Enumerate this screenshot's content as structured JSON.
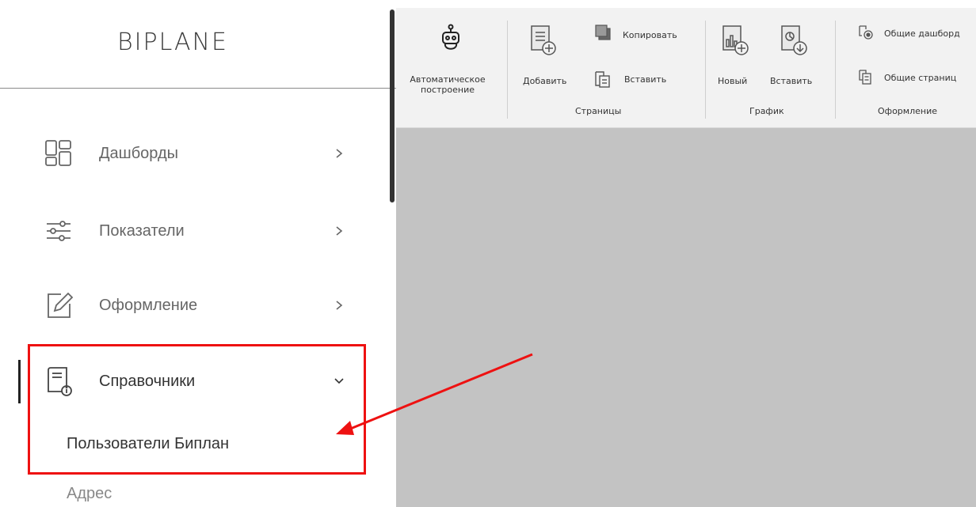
{
  "app": {
    "logo": "BIPLANE"
  },
  "sidebar": {
    "items": [
      {
        "label": "Дашборды",
        "icon": "dashboard-grid-icon"
      },
      {
        "label": "Показатели",
        "icon": "sliders-icon"
      },
      {
        "label": "Оформление",
        "icon": "edit-icon"
      },
      {
        "label": "Справочники",
        "icon": "reference-book-icon",
        "expanded": true
      }
    ],
    "sub_items": [
      {
        "label": "Пользователи Биплан"
      },
      {
        "label": "Адрес"
      }
    ]
  },
  "ribbon": {
    "auto_build": {
      "label_line1": "Автоматическое",
      "label_line2": "построение"
    },
    "pages": {
      "add": "Добавить",
      "copy": "Копировать",
      "paste": "Вставить",
      "group": "Страницы"
    },
    "chart": {
      "new": "Новый",
      "paste": "Вставить",
      "group": "График"
    },
    "design": {
      "shared_dashboards": "Общие дашборд",
      "shared_pages": "Общие страниц",
      "group": "Оформление"
    }
  },
  "colors": {
    "highlight": "#e11111",
    "canvas": "#c3c3c3",
    "ribbon": "#f2f2f2"
  }
}
